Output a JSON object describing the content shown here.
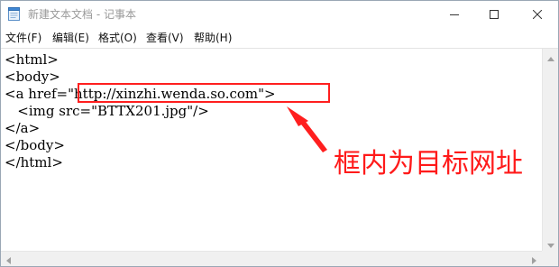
{
  "window": {
    "title": "新建文本文档 - 记事本",
    "icons": {
      "app": "notepad-icon",
      "minimize": "minimize-icon",
      "maximize": "maximize-icon",
      "close": "close-icon"
    }
  },
  "menu": {
    "items": [
      {
        "label": "文件(F)"
      },
      {
        "label": "编辑(E)"
      },
      {
        "label": "格式(O)"
      },
      {
        "label": "查看(V)"
      },
      {
        "label": "帮助(H)"
      }
    ]
  },
  "editor": {
    "lines": [
      "<html>",
      "<body>",
      "<a href=\"http://xinzhi.wenda.so.com\">",
      "   <img src=\"BTTX201.jpg\"/>",
      "</a>",
      "</body>",
      "</html>"
    ]
  },
  "annotation": {
    "text": "框内为目标网址",
    "color": "#ff1a1a"
  },
  "colors": {
    "title_text": "#999999",
    "scrollbar": "#f0f0f0",
    "highlight": "#ff1f1f"
  }
}
